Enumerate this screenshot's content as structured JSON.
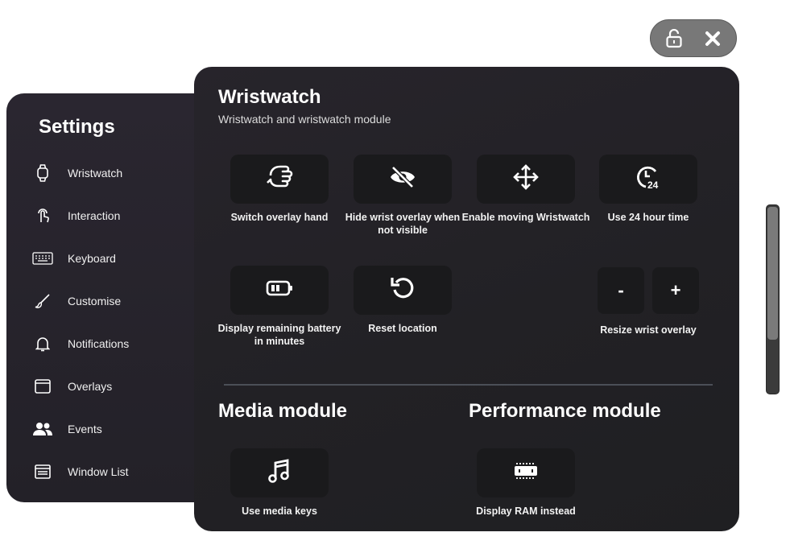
{
  "window_controls": {
    "lock_icon": "unlock-icon",
    "close_icon": "close-icon"
  },
  "sidebar": {
    "title": "Settings",
    "items": [
      {
        "label": "Wristwatch",
        "icon": "watch-icon"
      },
      {
        "label": "Interaction",
        "icon": "touch-icon"
      },
      {
        "label": "Keyboard",
        "icon": "keyboard-icon"
      },
      {
        "label": "Customise",
        "icon": "brush-icon"
      },
      {
        "label": "Notifications",
        "icon": "bell-icon"
      },
      {
        "label": "Overlays",
        "icon": "window-icon"
      },
      {
        "label": "Events",
        "icon": "people-icon"
      },
      {
        "label": "Window List",
        "icon": "window-list-icon"
      }
    ]
  },
  "main": {
    "title": "Wristwatch",
    "subtitle": "Wristwatch and wristwatch module",
    "options": [
      {
        "label": "Switch overlay hand",
        "icon": "hand-icon"
      },
      {
        "label": "Hide wrist overlay when not visible",
        "icon": "eye-off-icon"
      },
      {
        "label": "Enable moving Wristwatch",
        "icon": "move-icon"
      },
      {
        "label": "Use 24 hour time",
        "icon": "clock-24-icon"
      },
      {
        "label": "Display remaining battery in minutes",
        "icon": "battery-icon"
      },
      {
        "label": "Reset location",
        "icon": "reset-icon"
      }
    ],
    "resize": {
      "minus": "-",
      "plus": "+",
      "label": "Resize wrist overlay"
    },
    "media_module": {
      "title": "Media module",
      "option_label": "Use media keys",
      "icon": "music-icon"
    },
    "performance_module": {
      "title": "Performance module",
      "option_label": "Display RAM instead",
      "icon": "ram-icon"
    }
  },
  "scrollbar": {
    "position": 0.0
  }
}
